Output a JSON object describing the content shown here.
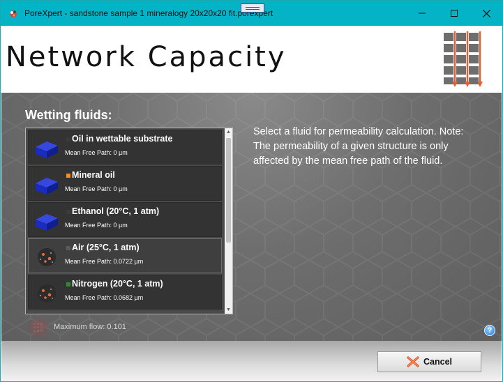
{
  "window": {
    "title": "PoreXpert - sandstone sample 1 mineralogy 20x20x20 fit.porexpert"
  },
  "header": {
    "page_title": "Network Capacity"
  },
  "main": {
    "section_title": "Wetting fluids:",
    "instructions": "Select a fluid for permeability calculation. Note: The permeability of a given structure is only affected by the mean free path of the fluid.",
    "fluids": [
      {
        "name": "Oil in wettable substrate",
        "mean_free_path": "Mean Free Path: 0 µm",
        "icon": "cube-icon",
        "swatch_color": "#3a3a3a",
        "selected": false
      },
      {
        "name": "Mineral oil",
        "mean_free_path": "Mean Free Path: 0 µm",
        "icon": "cube-icon",
        "swatch_color": "#ff8c1a",
        "selected": false
      },
      {
        "name": "Ethanol (20°C, 1 atm)",
        "mean_free_path": "Mean Free Path: 0 µm",
        "icon": "cube-icon",
        "swatch_color": "#3a3a3a",
        "selected": false
      },
      {
        "name": "Air (25°C, 1 atm)",
        "mean_free_path": "Mean Free Path: 0.0722 µm",
        "icon": "gas-particles-icon",
        "swatch_color": "#5a5a5a",
        "selected": true
      },
      {
        "name": "Nitrogen (20°C, 1 atm)",
        "mean_free_path": "Mean Free Path: 0.0682 µm",
        "icon": "gas-particles-icon",
        "swatch_color": "#2e8b2e",
        "selected": false
      }
    ],
    "max_flow_label": "Maximum flow: 0.101",
    "help_label": "?"
  },
  "footer": {
    "cancel_label": "Cancel"
  },
  "colors": {
    "titlebar": "#04b3c6",
    "accent_arrow": "#e0603a",
    "cube_blue": "#1a2bbf"
  }
}
